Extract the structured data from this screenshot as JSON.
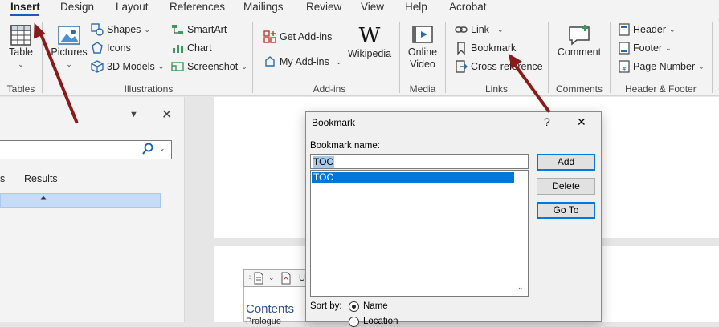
{
  "tabs": [
    "Insert",
    "Design",
    "Layout",
    "References",
    "Mailings",
    "Review",
    "View",
    "Help",
    "Acrobat"
  ],
  "ribbon": {
    "tables": {
      "table": "Table",
      "group": "Tables"
    },
    "illustrations": {
      "pictures": "Pictures",
      "shapes": "Shapes",
      "icons": "Icons",
      "models": "3D Models",
      "smartart": "SmartArt",
      "chart": "Chart",
      "screenshot": "Screenshot",
      "group": "Illustrations"
    },
    "addins": {
      "get": "Get Add-ins",
      "my": "My Add-ins",
      "wikipedia": "Wikipedia",
      "group": "Add-ins"
    },
    "media": {
      "online_video_1": "Online",
      "online_video_2": "Video",
      "group": "Media"
    },
    "links": {
      "link": "Link",
      "bookmark": "Bookmark",
      "cross": "Cross-reference",
      "group": "Links"
    },
    "comments": {
      "comment": "Comment",
      "group": "Comments"
    },
    "header_footer": {
      "header": "Header",
      "footer": "Footer",
      "page_number": "Page Number",
      "group": "Header & Footer"
    }
  },
  "nav_pane": {
    "results_tab": "Results",
    "headings_tab_fragment": "s"
  },
  "document": {
    "toc_heading": "Contents",
    "toc_first_line": "Prologue",
    "toc_toolbar_fragment": "U"
  },
  "dialog": {
    "title": "Bookmark",
    "help": "?",
    "close": "✕",
    "name_label": "Bookmark name:",
    "name_value": "TOC",
    "list_items": [
      "TOC"
    ],
    "buttons": {
      "add": "Add",
      "delete": "Delete",
      "goto": "Go To"
    },
    "sort_label": "Sort by:",
    "sort_options": [
      "Name",
      "Location"
    ],
    "sort_selected": "Name"
  },
  "colors": {
    "accent": "#185abd",
    "arrow": "#8b1a1a",
    "selection": "#0078d7"
  }
}
